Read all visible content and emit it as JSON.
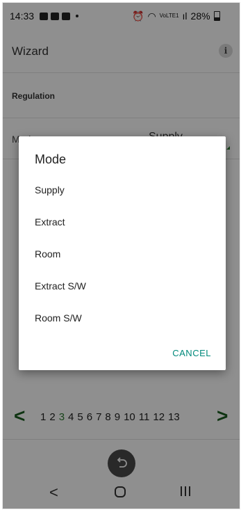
{
  "status_bar": {
    "time": "14:33",
    "signal_label": "VoLTE1",
    "battery": "28%"
  },
  "app_bar": {
    "title": "Wizard",
    "info_icon": "i"
  },
  "section": {
    "title": "Regulation"
  },
  "mode_row": {
    "label": "Mode",
    "value": "Supply"
  },
  "dialog": {
    "title": "Mode",
    "options": [
      "Supply",
      "Extract",
      "Room",
      "Extract S/W",
      "Room S/W"
    ],
    "cancel": "CANCEL"
  },
  "pager": {
    "prev": "<",
    "next": ">",
    "pages": [
      "1",
      "2",
      "3",
      "4",
      "5",
      "6",
      "7",
      "8",
      "9",
      "10",
      "11",
      "12",
      "13"
    ],
    "current": "3"
  },
  "colors": {
    "accent_green": "#2e7d32",
    "dialog_button": "#00897b",
    "scrim": "rgba(0,0,0,0.44)"
  }
}
